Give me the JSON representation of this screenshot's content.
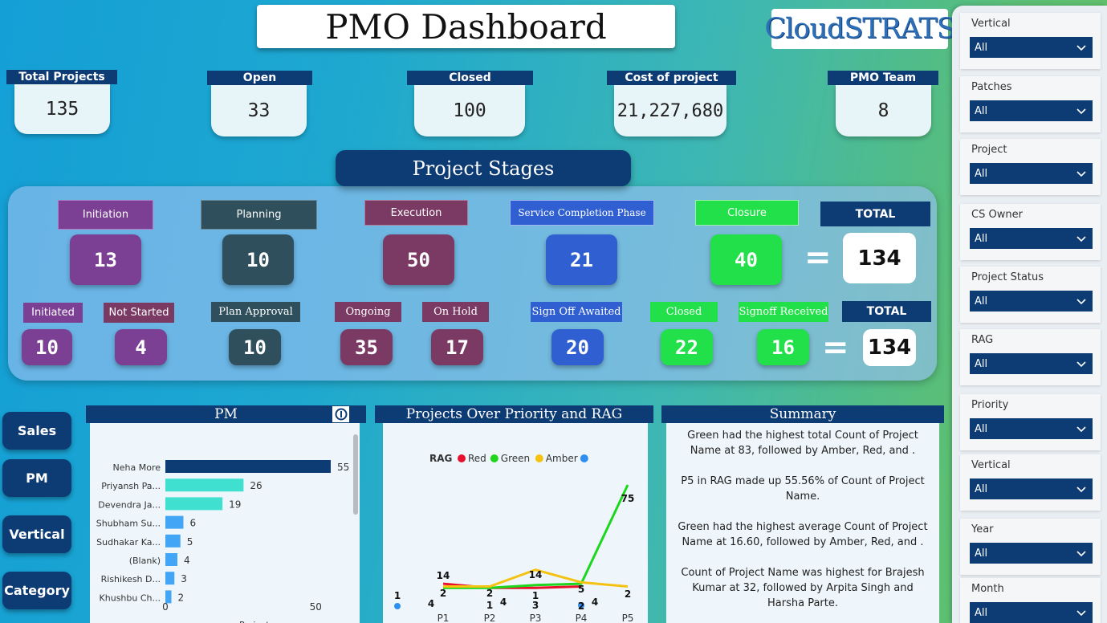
{
  "header": {
    "title": "PMO Dashboard",
    "logo_text": "CloudSTRATS"
  },
  "kpis": [
    {
      "label": "Total Projects",
      "value": "135"
    },
    {
      "label": "Open",
      "value": "33"
    },
    {
      "label": "Closed",
      "value": "100"
    },
    {
      "label": "Cost of project",
      "value": "21,227,680"
    },
    {
      "label": "PMO Team",
      "value": "8"
    }
  ],
  "stages": {
    "title": "Project Stages",
    "row1": [
      {
        "label": "Initiation",
        "value": "13"
      },
      {
        "label": "Planning",
        "value": "10"
      },
      {
        "label": "Execution",
        "value": "50"
      },
      {
        "label": "Service Completion Phase",
        "value": "21"
      },
      {
        "label": "Closure",
        "value": "40"
      }
    ],
    "row1_total": {
      "label": "TOTAL",
      "value": "134"
    },
    "row2": [
      {
        "label": "Initiated",
        "value": "10"
      },
      {
        "label": "Not Started",
        "value": "4"
      },
      {
        "label": "Plan Approval",
        "value": "10"
      },
      {
        "label": "Ongoing",
        "value": "35"
      },
      {
        "label": "On Hold",
        "value": "17"
      },
      {
        "label": "Sign Off Awaited",
        "value": "20"
      },
      {
        "label": "Closed",
        "value": "22"
      },
      {
        "label": "Signoff Received",
        "value": "16"
      }
    ],
    "row2_total": {
      "label": "TOTAL",
      "value": "134"
    },
    "equals": "="
  },
  "nav": [
    "Sales",
    "PM",
    "Vertical",
    "Category"
  ],
  "pm_panel": {
    "title": "PM",
    "info_icon": "info-icon"
  },
  "priority_panel": {
    "title": "Projects Over Priority and RAG"
  },
  "summary": {
    "title": "Summary",
    "paragraphs": [
      "Green had the highest total Count of Project Name at 83, followed by Amber, Red, and .",
      "P5 in RAG  made up 55.56% of Count of Project Name.",
      "Green had the highest average Count of Project Name at 16.60, followed by Amber, Red, and .",
      "Count of Project Name was highest for Brajesh Kumar at 32, followed by Arpita Singh and Harsha Parte."
    ]
  },
  "slicers": [
    {
      "label": "Vertical",
      "value": "All"
    },
    {
      "label": "Patches",
      "value": "All"
    },
    {
      "label": "Project",
      "value": "All"
    },
    {
      "label": "CS Owner",
      "value": "All"
    },
    {
      "label": "Project Status",
      "value": "All"
    },
    {
      "label": "RAG",
      "value": "All"
    },
    {
      "label": "Priority",
      "value": "All"
    },
    {
      "label": "Vertical",
      "value": "All"
    },
    {
      "label": "Year",
      "value": "All"
    },
    {
      "label": "Month",
      "value": "All"
    }
  ],
  "colors": {
    "navy": "#0d3b73",
    "initiation": "#7b3f94",
    "planning": "#2f4f5c",
    "execution": "#7a3a63",
    "service": "#2f5fd0",
    "closure": "#22e04a",
    "pm_bar_top": "#0d3b73",
    "pm_bar_teal": "#40e0d0",
    "pm_bar_blue": "#42a5f5",
    "red": "#e8112d",
    "green": "#1ed61e",
    "amber": "#f5c211",
    "blank": "#2f8ff0"
  },
  "chart_data": [
    {
      "type": "bar",
      "orientation": "horizontal",
      "title": "PM",
      "categories": [
        "Neha More",
        "Priyansh Pa...",
        "Devendra Ja...",
        "Shubham Su...",
        "Sudhakar Ka...",
        "(Blank)",
        "Rishikesh D...",
        "Khushbu Ch..."
      ],
      "values": [
        55,
        26,
        19,
        6,
        5,
        4,
        3,
        2
      ],
      "xlim": [
        0,
        55
      ],
      "xticks": [
        "0",
        "50"
      ],
      "xlabel": "Project..."
    },
    {
      "type": "line",
      "title": "Projects Over Priority and RAG",
      "legend_title": "RAG",
      "legend_position": "top",
      "xlabel": "Priority",
      "categories": [
        "P1",
        "P2",
        "P3",
        "P4",
        "P5"
      ],
      "series": [
        {
          "name": "Red",
          "color": "#e8112d",
          "values": [
            4,
            1,
            1,
            2,
            null
          ]
        },
        {
          "name": "Green",
          "color": "#1ed61e",
          "values": [
            1,
            1,
            3,
            4,
            75
          ]
        },
        {
          "name": "Amber",
          "color": "#f5c211",
          "values": [
            2,
            2,
            14,
            5,
            2
          ]
        },
        {
          "name": "",
          "color": "#2f8ff0",
          "values": [
            1,
            null,
            null,
            2,
            null
          ]
        }
      ],
      "labels": [
        {
          "x": "P1",
          "text": "14"
        },
        {
          "x": "P1",
          "text": "2"
        },
        {
          "x": "P1",
          "text": "4"
        },
        {
          "x": "P1",
          "text": "1"
        },
        {
          "x": "P2",
          "text": "2"
        },
        {
          "x": "P2",
          "text": "1"
        },
        {
          "x": "P2",
          "text": "4"
        },
        {
          "x": "P3",
          "text": "14"
        },
        {
          "x": "P3",
          "text": "1"
        },
        {
          "x": "P3",
          "text": "3"
        },
        {
          "x": "P4",
          "text": "5"
        },
        {
          "x": "P4",
          "text": "2"
        },
        {
          "x": "P4",
          "text": "4"
        },
        {
          "x": "P5",
          "text": "75"
        },
        {
          "x": "P5",
          "text": "2"
        }
      ]
    }
  ]
}
